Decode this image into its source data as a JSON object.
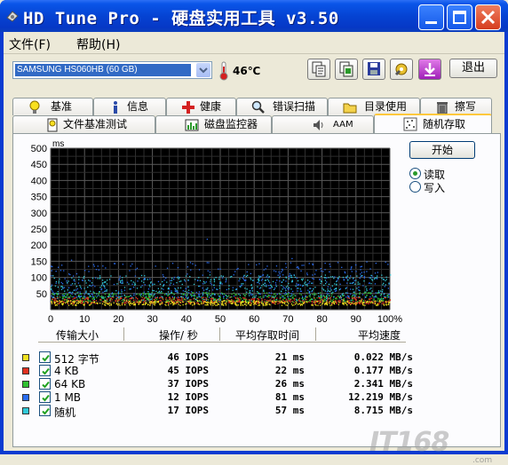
{
  "window": {
    "title": "HD Tune Pro - 硬盘实用工具 v3.50"
  },
  "menu": {
    "items": [
      "文件(F)",
      "帮助(H)"
    ]
  },
  "toolbar": {
    "drive": "SAMSUNG HS060HB  (60 GB)",
    "temperature": "46℃",
    "exit_label": "退出",
    "icon_buttons": [
      "copy-text-icon",
      "copy-screen-icon",
      "save-icon",
      "options-icon",
      "minimize-to-tray-icon"
    ]
  },
  "tabs": {
    "row1": [
      {
        "label": "基准",
        "icon": "lightbulb-icon"
      },
      {
        "label": "信息",
        "icon": "info-icon"
      },
      {
        "label": "健康",
        "icon": "health-cross-icon"
      },
      {
        "label": "错误扫描",
        "icon": "magnifier-icon"
      },
      {
        "label": "目录使用",
        "icon": "folder-icon"
      },
      {
        "label": "擦写",
        "icon": "trash-icon"
      }
    ],
    "row2": [
      {
        "label": "文件基准测试",
        "icon": "file-benchmark-icon"
      },
      {
        "label": "磁盘监控器",
        "icon": "monitor-icon"
      },
      {
        "label": "AAM",
        "icon": "speaker-icon"
      },
      {
        "label": "随机存取",
        "icon": "random-access-icon",
        "active": true
      }
    ]
  },
  "controls": {
    "start_label": "开始",
    "read_label": "读取",
    "write_label": "写入",
    "selected": "read"
  },
  "chart_data": {
    "type": "scatter",
    "ylabel": "ms",
    "ylim": [
      0,
      500
    ],
    "xlim": [
      0,
      100
    ],
    "yticks": [
      "500",
      "450",
      "400",
      "350",
      "300",
      "250",
      "200",
      "150",
      "100",
      "50"
    ],
    "xticks": [
      "0",
      "10",
      "20",
      "30",
      "40",
      "50",
      "60",
      "70",
      "80",
      "90",
      "100%"
    ],
    "grid": true,
    "background": "#000000",
    "series": [
      {
        "color": "#f0e020",
        "band": [
          15,
          30
        ]
      },
      {
        "color": "#e03020",
        "band": [
          20,
          40
        ]
      },
      {
        "color": "#30c030",
        "band": [
          25,
          55
        ]
      },
      {
        "color": "#2a6cf0",
        "band": [
          40,
          150
        ]
      },
      {
        "color": "#30c8d8",
        "band": [
          30,
          110
        ]
      }
    ]
  },
  "results": {
    "headers": [
      "传输大小",
      "操作/ 秒",
      "平均存取时间",
      "平均速度"
    ],
    "rows": [
      {
        "size": "512 字节",
        "iops": "46 IOPS",
        "time": "21 ms",
        "speed": "0.022 MB/s",
        "color": "#f0e020"
      },
      {
        "size": "4 KB",
        "iops": "45 IOPS",
        "time": "22 ms",
        "speed": "0.177 MB/s",
        "color": "#e03020"
      },
      {
        "size": "64 KB",
        "iops": "37 IOPS",
        "time": "26 ms",
        "speed": "2.341 MB/s",
        "color": "#30c030"
      },
      {
        "size": "1 MB",
        "iops": "12 IOPS",
        "time": "81 ms",
        "speed": "12.219 MB/s",
        "color": "#2a6cf0"
      },
      {
        "size": "随机",
        "iops": "17 IOPS",
        "time": "57 ms",
        "speed": "8.715 MB/s",
        "color": "#30c8d8"
      }
    ]
  },
  "watermark": {
    "main": "IT168",
    "sub": ".com"
  }
}
